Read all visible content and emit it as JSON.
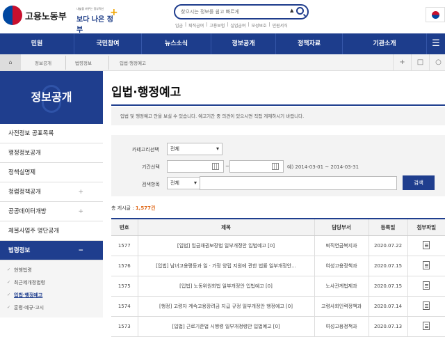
{
  "header": {
    "org_name": "고용노동부",
    "slogan_small": "내삶을 바꾸는 정부혁신",
    "slogan_main": "보다 나은 정부",
    "search_placeholder": "찾으시는 정보를 쉽고 빠르게",
    "search_caret": "▲",
    "quick_links": [
      "임금",
      "퇴직금여",
      "고용보험",
      "실업급여",
      "모성보호",
      "민원서식"
    ],
    "flag_icon": "korean-flag-icon"
  },
  "gnb": [
    "민원",
    "국민참여",
    "뉴스소식",
    "정보공개",
    "정책자료",
    "기관소개"
  ],
  "breadcrumb": [
    "정보공개",
    "법령정보",
    "입법·행정예고"
  ],
  "tools": [
    "+",
    "□",
    "○"
  ],
  "lnb": {
    "title": "정보공개",
    "items": [
      {
        "label": "사전정보 공표목록",
        "plus": ""
      },
      {
        "label": "행정정보공개",
        "plus": ""
      },
      {
        "label": "정책실명제",
        "plus": ""
      },
      {
        "label": "청렴정책공개",
        "plus": "+"
      },
      {
        "label": "공공데이터개방",
        "plus": "+"
      },
      {
        "label": "체불사업주 명단공개",
        "plus": ""
      },
      {
        "label": "법령정보",
        "plus": "−"
      }
    ],
    "sub_items": [
      "현행법령",
      "최근제개정법령",
      "입법·행정예고",
      "훈령·예규·고시"
    ]
  },
  "content": {
    "title": "입법·행정예고",
    "description": "입법 및 행정예고 안을 보실 수 있습니다. 예고기간 중 의견이 있으시면 직접 게재하시기 바랍니다.",
    "search": {
      "category_label": "카테고리선택",
      "category_value": "전체",
      "period_label": "기간선택",
      "period_sep": "~",
      "period_example": "예) 2014-03-01 ~ 2014-03-31",
      "keyword_label": "검색항목",
      "keyword_value": "전체",
      "button": "검색"
    },
    "total_label": "총 게시글 :",
    "total_count": "1,577건",
    "table": {
      "headers": [
        "번호",
        "제목",
        "담당부서",
        "등록일",
        "첨부파일"
      ],
      "rows": [
        {
          "no": "1577",
          "title": "[입법] 임금채권보장법 일부개정안 입법예고 [0]",
          "dept": "퇴직연금복지과",
          "date": "2020.07.22"
        },
        {
          "no": "1576",
          "title": "[입법] 남녀고용평등과 일ㆍ가정 양립 지원에 관한 법률 일부개정안...",
          "dept": "여성고용정책과",
          "date": "2020.07.15"
        },
        {
          "no": "1575",
          "title": "[입법] 노동위원회법 일부개정안 입법예고 [0]",
          "dept": "노사관계법제과",
          "date": "2020.07.15"
        },
        {
          "no": "1574",
          "title": "[행정] 고령자 계속고용장려금 지급 규정 일부개정안 행정예고 [0]",
          "dept": "고령사회인력정책과",
          "date": "2020.07.14"
        },
        {
          "no": "1573",
          "title": "[입법] 근로기준법 시행령 일부개정령안 입법예고 [0]",
          "dept": "여성고용정책과",
          "date": "2020.07.13"
        }
      ]
    }
  },
  "colors": {
    "brand": "#1d3d8c",
    "accent": "#e06a1a"
  }
}
